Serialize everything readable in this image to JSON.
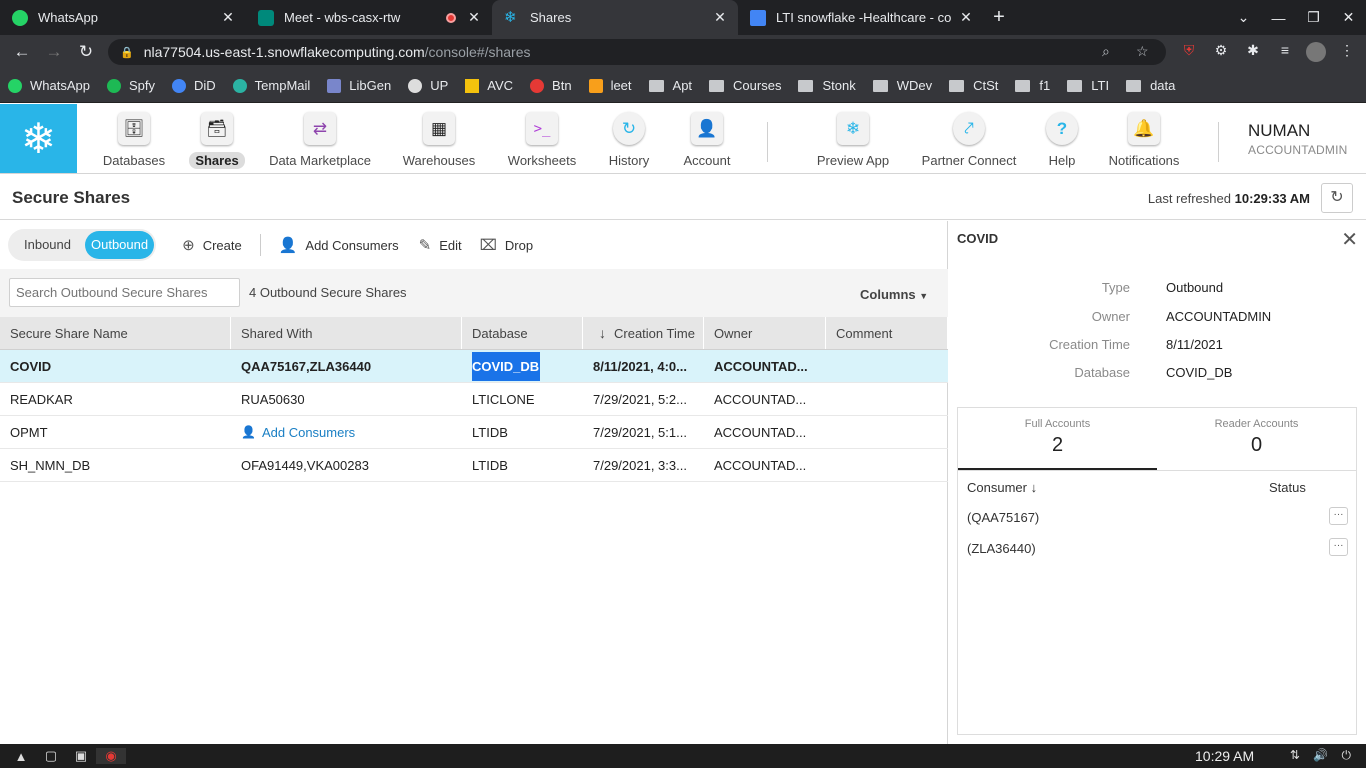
{
  "browser": {
    "tabs": [
      {
        "title": "WhatsApp",
        "color": "#25d366"
      },
      {
        "title": "Meet - wbs-casx-rtw",
        "color": "#00897b"
      },
      {
        "title": "Shares",
        "color": "#29b5e8"
      },
      {
        "title": "LTI snowflake -Healthcare - co",
        "color": "#4285f4"
      }
    ],
    "url_host": "nla77504.us-east-1.snowflakecomputing.com",
    "url_path": "/console#/shares",
    "bookmarks": [
      "WhatsApp",
      "Spfy",
      "DiD",
      "TempMail",
      "LibGen",
      "UP",
      "AVC",
      "Btn",
      "leet",
      "Apt",
      "Courses",
      "Stonk",
      "WDev",
      "CtSt",
      "f1",
      "LTI",
      "data"
    ]
  },
  "nav": {
    "items": [
      "Databases",
      "Shares",
      "Data Marketplace",
      "Warehouses",
      "Worksheets",
      "History",
      "Account"
    ],
    "right_items": [
      "Preview App",
      "Partner Connect",
      "Help",
      "Notifications"
    ],
    "user_name": "NUMAN",
    "user_role": "ACCOUNTADMIN"
  },
  "page": {
    "title": "Secure Shares",
    "last_refreshed_label": "Last refreshed",
    "last_refreshed_time": "10:29:33 AM"
  },
  "toolbar": {
    "inbound": "Inbound",
    "outbound": "Outbound",
    "create": "Create",
    "add_consumers": "Add Consumers",
    "edit": "Edit",
    "drop": "Drop"
  },
  "filter": {
    "search_placeholder": "Search Outbound Secure Shares",
    "count": "4 Outbound Secure Shares",
    "columns": "Columns"
  },
  "table": {
    "headers": [
      "Secure Share Name",
      "Shared With",
      "Database",
      "Creation Time",
      "Owner",
      "Comment"
    ],
    "rows": [
      {
        "name": "COVID",
        "shared_with": "QAA75167,ZLA36440",
        "database": "COVID_DB",
        "created": "8/11/2021, 4:0...",
        "owner": "ACCOUNTAD...",
        "comment": ""
      },
      {
        "name": "READKAR",
        "shared_with": "RUA50630",
        "database": "LTICLONE",
        "created": "7/29/2021, 5:2...",
        "owner": "ACCOUNTAD...",
        "comment": ""
      },
      {
        "name": "OPMT",
        "shared_with": "Add Consumers",
        "database": "LTIDB",
        "created": "7/29/2021, 5:1...",
        "owner": "ACCOUNTAD...",
        "comment": ""
      },
      {
        "name": "SH_NMN_DB",
        "shared_with": "OFA91449,VKA00283",
        "database": "LTIDB",
        "created": "7/29/2021, 3:3...",
        "owner": "ACCOUNTAD...",
        "comment": ""
      }
    ]
  },
  "detail": {
    "title": "COVID",
    "fields": [
      {
        "k": "Type",
        "v": "Outbound"
      },
      {
        "k": "Owner",
        "v": "ACCOUNTADMIN"
      },
      {
        "k": "Creation Time",
        "v": "8/11/2021"
      },
      {
        "k": "Database",
        "v": "COVID_DB"
      }
    ],
    "full_accounts_label": "Full Accounts",
    "full_accounts_count": "2",
    "reader_accounts_label": "Reader Accounts",
    "reader_accounts_count": "0",
    "consumer_header": "Consumer ↓",
    "status_header": "Status",
    "consumers": [
      "(QAA75167)",
      "(ZLA36440)"
    ]
  },
  "taskbar": {
    "clock": "10:29 AM"
  },
  "colors": {
    "brand": "#29b5e8",
    "selected_row": "#d9f3fa",
    "highlight": "#1a73e8"
  }
}
